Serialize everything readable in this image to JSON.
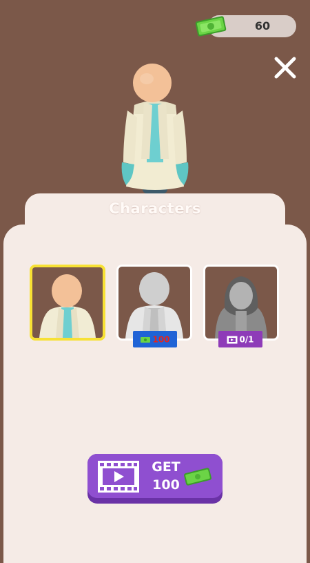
{
  "currency": {
    "amount": "60"
  },
  "panel": {
    "title": "Characters"
  },
  "characters": [
    {
      "name": "scientist",
      "selected": true,
      "locked": false
    },
    {
      "name": "doctor",
      "selected": false,
      "locked": true,
      "price": "100"
    },
    {
      "name": "hooded",
      "selected": false,
      "locked": true,
      "ads_progress": "0/1"
    }
  ],
  "get_button": {
    "line1": "GET",
    "line2": "100"
  },
  "colors": {
    "background": "#7b5849",
    "panel": "#f5ebe6",
    "selected_border": "#f7e134",
    "button": "#8f4fd0",
    "cash": "#5fcf3a"
  },
  "icons": {
    "cash": "banknote-icon",
    "close": "close-icon",
    "video": "video-ad-icon"
  }
}
